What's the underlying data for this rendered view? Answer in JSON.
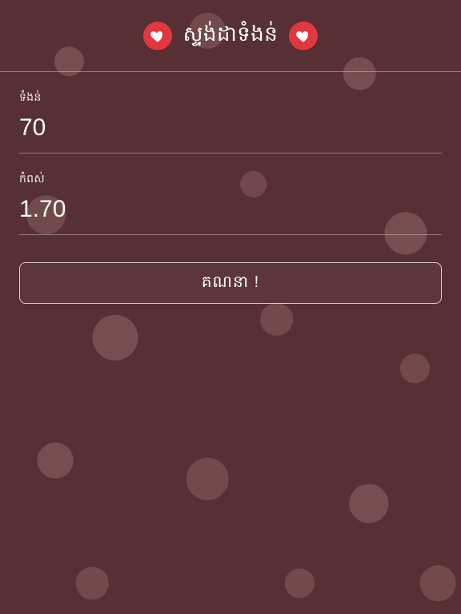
{
  "header": {
    "title": "ស្ទង់ដាទំងន់",
    "left_icon": "heart-icon",
    "right_icon": "heart-icon"
  },
  "fields": {
    "weight": {
      "label": "ទំងន់",
      "value": "70"
    },
    "height": {
      "label": "កំពស់",
      "value": "1.70"
    }
  },
  "button": {
    "label": "គណនា !"
  },
  "colors": {
    "accent": "#e2373f",
    "bg": "#5a2e34",
    "text": "#ffffff"
  }
}
